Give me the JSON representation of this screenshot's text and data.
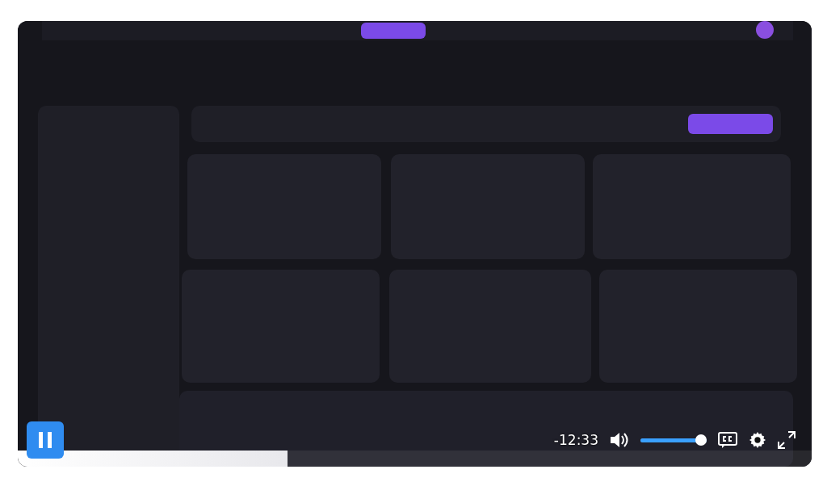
{
  "player": {
    "playing": true,
    "progress": {
      "level": 0.34
    },
    "time_remaining": "-12:33",
    "volume": {
      "level": 1.0
    }
  }
}
